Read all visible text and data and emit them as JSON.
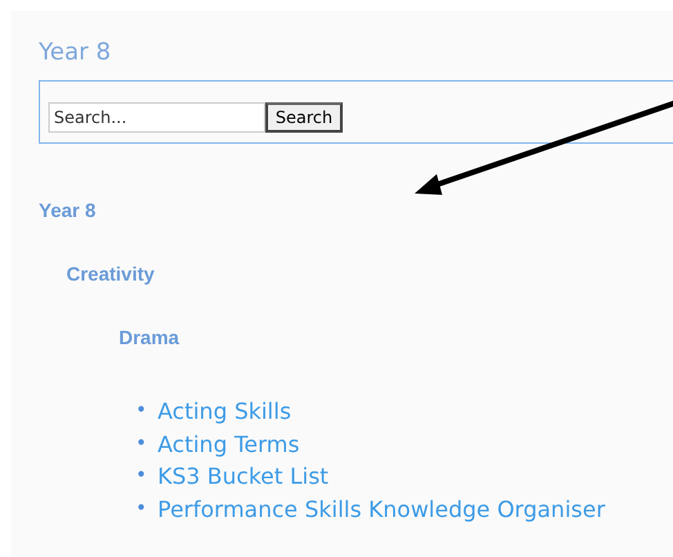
{
  "page_title": "Year 8",
  "search": {
    "placeholder": "Search...",
    "button": "Search"
  },
  "tree": [
    {
      "label": "Year 8",
      "children": [
        {
          "label": "Creativity",
          "children": [
            {
              "label": "Drama",
              "links": [
                {
                  "bullet": "•",
                  "label": "Acting Skills"
                },
                {
                  "bullet": "•",
                  "label": "Acting Terms"
                },
                {
                  "bullet": "•",
                  "label": "KS3 Bucket List"
                },
                {
                  "bullet": "•",
                  "label": "Performance Skills Knowledge Organiser"
                }
              ]
            }
          ]
        }
      ]
    }
  ]
}
